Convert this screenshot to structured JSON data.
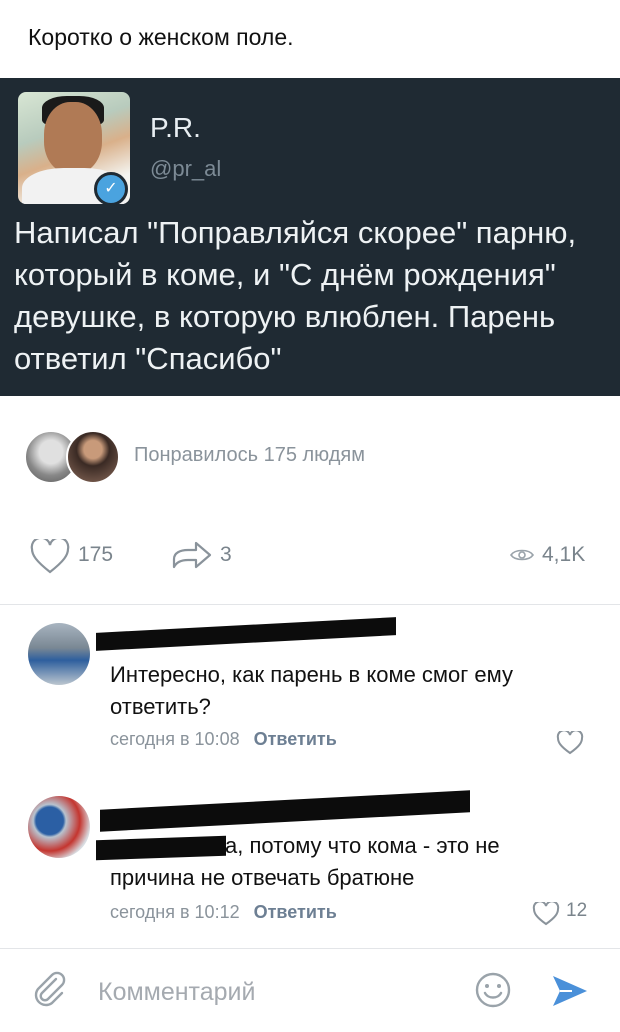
{
  "post": {
    "text": "Коротко о женском поле."
  },
  "tweet": {
    "name": "P.R.",
    "handle": "@pr_al",
    "body": "Написал \"Поправляйся скорее\" парню, который в коме, и \"С днём рождения\" девушке, в которую влюблен. Парень ответил \"Спасибо\""
  },
  "likes": {
    "text": "Понравилось 175 людям"
  },
  "actions": {
    "like_count": "175",
    "share_count": "3",
    "views_count": "4,1K"
  },
  "comments": [
    {
      "text": "Интересно, как парень в коме смог ему ответить?",
      "time": "сегодня в 10:08",
      "reply_label": "Ответить",
      "likes": ""
    },
    {
      "text": "а, потому что кома - это не причина не отвечать братюне",
      "time": "сегодня в 10:12",
      "reply_label": "Ответить",
      "likes": "12"
    }
  ],
  "composer": {
    "placeholder": "Комментарий"
  },
  "colors": {
    "tweet_bg": "#1f2a33",
    "accent": "#4a90d9",
    "muted": "#8a939b"
  },
  "icons": [
    "verified-icon",
    "heart-icon",
    "share-icon",
    "eye-icon",
    "clip-icon",
    "emoji-icon",
    "send-icon"
  ]
}
